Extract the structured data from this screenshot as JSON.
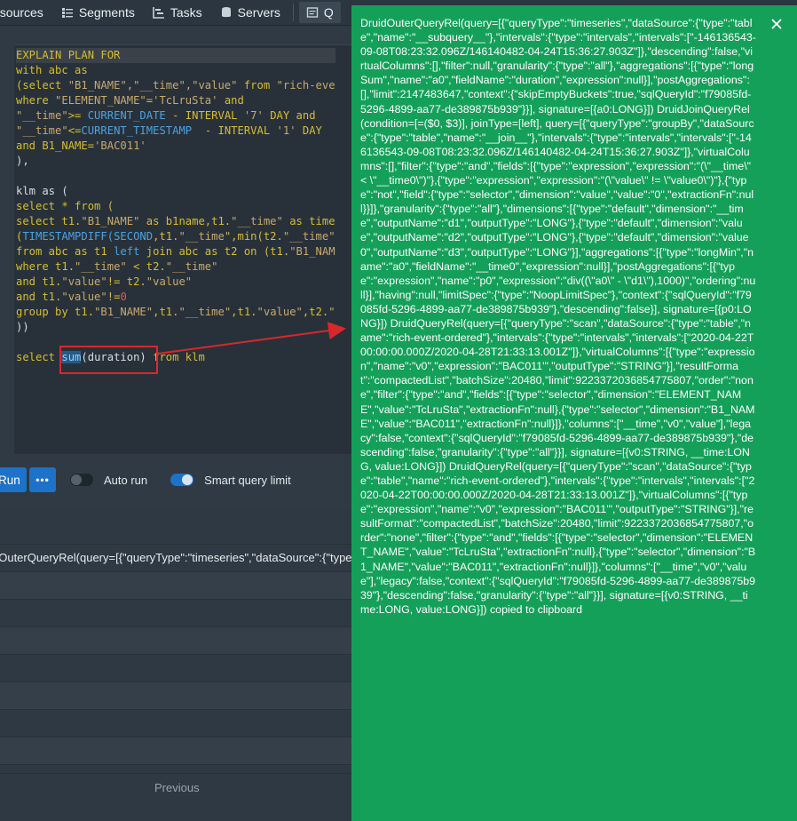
{
  "nav": {
    "items": [
      {
        "label": "asources",
        "icon": "datasource-icon"
      },
      {
        "label": "Segments",
        "icon": "segments-icon"
      },
      {
        "label": "Tasks",
        "icon": "tasks-icon"
      },
      {
        "label": "Servers",
        "icon": "servers-icon"
      },
      {
        "label": "Q",
        "icon": "query-icon"
      }
    ]
  },
  "editor": {
    "lines": [
      [
        {
          "t": "EXPLAIN PLAN FOR",
          "c": "y"
        }
      ],
      [
        {
          "t": "with abc as",
          "c": "y"
        }
      ],
      [
        {
          "t": "(select ",
          "c": "y"
        },
        {
          "t": "\"B1_NAME\",\"__time\",\"value\"",
          "c": "s"
        },
        {
          "t": " from ",
          "c": "y"
        },
        {
          "t": "\"rich-eve",
          "c": "s"
        }
      ],
      [
        {
          "t": "where ",
          "c": "y"
        },
        {
          "t": "\"ELEMENT_NAME\"",
          "c": "s"
        },
        {
          "t": "=",
          "c": "y"
        },
        {
          "t": "'TcLruSta'",
          "c": "s"
        },
        {
          "t": " and",
          "c": "y"
        }
      ],
      [
        {
          "t": "\"__time\"",
          "c": "s"
        },
        {
          "t": ">= ",
          "c": "y"
        },
        {
          "t": "CURRENT_DATE",
          "c": "b"
        },
        {
          "t": " - INTERVAL ",
          "c": "y"
        },
        {
          "t": "'7'",
          "c": "s"
        },
        {
          "t": " DAY and",
          "c": "y"
        }
      ],
      [
        {
          "t": "\"__time\"",
          "c": "s"
        },
        {
          "t": "<=",
          "c": "y"
        },
        {
          "t": "CURRENT_TIMESTAMP",
          "c": "b"
        },
        {
          "t": "  - INTERVAL ",
          "c": "y"
        },
        {
          "t": "'1'",
          "c": "s"
        },
        {
          "t": " DAY",
          "c": "y"
        }
      ],
      [
        {
          "t": "and B1_NAME=",
          "c": "y"
        },
        {
          "t": "'BAC011'",
          "c": "s"
        }
      ],
      [
        {
          "t": "),",
          "c": "c"
        }
      ],
      [
        {
          "t": "",
          "c": "c"
        }
      ],
      [
        {
          "t": "klm as (",
          "c": "c"
        }
      ],
      [
        {
          "t": "select * from (",
          "c": "y"
        }
      ],
      [
        {
          "t": "select t1.",
          "c": "y"
        },
        {
          "t": "\"B1_NAME\"",
          "c": "s"
        },
        {
          "t": " as b1name,t1.",
          "c": "y"
        },
        {
          "t": "\"__time\"",
          "c": "s"
        },
        {
          "t": " as time",
          "c": "y"
        }
      ],
      [
        {
          "t": "(",
          "c": "y"
        },
        {
          "t": "TIMESTAMPDIFF(SECOND",
          "c": "b"
        },
        {
          "t": ",t1.",
          "c": "y"
        },
        {
          "t": "\"__time\"",
          "c": "s"
        },
        {
          "t": ",min(t2.",
          "c": "y"
        },
        {
          "t": "\"__time\"",
          "c": "s"
        }
      ],
      [
        {
          "t": "from abc as t1 ",
          "c": "y"
        },
        {
          "t": "left",
          "c": "b"
        },
        {
          "t": " join abc as t2 on (t1.",
          "c": "y"
        },
        {
          "t": "\"B1_NAM",
          "c": "s"
        }
      ],
      [
        {
          "t": "where t1.",
          "c": "y"
        },
        {
          "t": "\"__time\"",
          "c": "s"
        },
        {
          "t": " < t2.",
          "c": "y"
        },
        {
          "t": "\"__time\"",
          "c": "s"
        }
      ],
      [
        {
          "t": "and t1.",
          "c": "y"
        },
        {
          "t": "\"value\"",
          "c": "s"
        },
        {
          "t": "!= t2.",
          "c": "y"
        },
        {
          "t": "\"value\"",
          "c": "s"
        }
      ],
      [
        {
          "t": "and t1.",
          "c": "y"
        },
        {
          "t": "\"value\"",
          "c": "s"
        },
        {
          "t": "!=",
          "c": "y"
        },
        {
          "t": "0",
          "c": "n"
        }
      ],
      [
        {
          "t": "group by t1.",
          "c": "y"
        },
        {
          "t": "\"B1_NAME\"",
          "c": "s"
        },
        {
          "t": ",t1.",
          "c": "y"
        },
        {
          "t": "\"__time\"",
          "c": "s"
        },
        {
          "t": ",t1.",
          "c": "y"
        },
        {
          "t": "\"value\"",
          "c": "s"
        },
        {
          "t": ",t2.",
          "c": "y"
        },
        {
          "t": "\"",
          "c": "s"
        }
      ],
      [
        {
          "t": "))",
          "c": "c"
        }
      ],
      [
        {
          "t": "",
          "c": "c"
        }
      ],
      [
        {
          "t": "select ",
          "c": "y"
        },
        {
          "t": "sum",
          "c": "sel"
        },
        {
          "t": "(duration)",
          "c": "c"
        },
        {
          "t": " from klm",
          "c": "y"
        }
      ]
    ]
  },
  "runbar": {
    "run_label": "Run",
    "more_label": "•••",
    "auto_run_label": "Auto run",
    "auto_run_on": false,
    "smart_limit_label": "Smart query limit",
    "smart_limit_on": true
  },
  "results": {
    "header": "l",
    "first_row": "dOuterQueryRel(query=[{\"queryType\":\"timeseries\",\"dataSource\":{\"type",
    "pager_previous": "Previous"
  },
  "toast": {
    "message": "DruidOuterQueryRel(query=[{\"queryType\":\"timeseries\",\"dataSource\":{\"type\":\"table\",\"name\":\"__subquery__\"},\"intervals\":{\"type\":\"intervals\",\"intervals\":[\"-146136543-09-08T08:23:32.096Z/146140482-04-24T15:36:27.903Z\"]},\"descending\":false,\"virtualColumns\":[],\"filter\":null,\"granularity\":{\"type\":\"all\"},\"aggregations\":[{\"type\":\"longSum\",\"name\":\"a0\",\"fieldName\":\"duration\",\"expression\":null}],\"postAggregations\":[],\"limit\":2147483647,\"context\":{\"skipEmptyBuckets\":true,\"sqlQueryId\":\"f79085fd-5296-4899-aa77-de389875b939\"}}], signature=[{a0:LONG}]) DruidJoinQueryRel(condition=[=($0, $3)], joinType=[left], query=[{\"queryType\":\"groupBy\",\"dataSource\":{\"type\":\"table\",\"name\":\"__join__\"},\"intervals\":{\"type\":\"intervals\",\"intervals\":[\"-146136543-09-08T08:23:32.096Z/146140482-04-24T15:36:27.903Z\"]},\"virtualColumns\":[],\"filter\":{\"type\":\"and\",\"fields\":[{\"type\":\"expression\",\"expression\":\"(\\\"__time\\\" < \\\"__time0\\\")\"},{\"type\":\"expression\",\"expression\":\"(\\\"value\\\" != \\\"value0\\\")\"},{\"type\":\"not\",\"field\":{\"type\":\"selector\",\"dimension\":\"value\",\"value\":\"0\",\"extractionFn\":null}}]},\"granularity\":{\"type\":\"all\"},\"dimensions\":[{\"type\":\"default\",\"dimension\":\"__time\",\"outputName\":\"d1\",\"outputType\":\"LONG\"},{\"type\":\"default\",\"dimension\":\"value\",\"outputName\":\"d2\",\"outputType\":\"LONG\"},{\"type\":\"default\",\"dimension\":\"value0\",\"outputName\":\"d3\",\"outputType\":\"LONG\"}],\"aggregations\":[{\"type\":\"longMin\",\"name\":\"a0\",\"fieldName\":\"__time0\",\"expression\":null}],\"postAggregations\":[{\"type\":\"expression\",\"name\":\"p0\",\"expression\":\"div((\\\"a0\\\" - \\\"d1\\\"),1000)\",\"ordering\":null}],\"having\":null,\"limitSpec\":{\"type\":\"NoopLimitSpec\"},\"context\":{\"sqlQueryId\":\"f79085fd-5296-4899-aa77-de389875b939\"},\"descending\":false}], signature=[{p0:LONG}]) DruidQueryRel(query=[{\"queryType\":\"scan\",\"dataSource\":{\"type\":\"table\",\"name\":\"rich-event-ordered\"},\"intervals\":{\"type\":\"intervals\",\"intervals\":[\"2020-04-22T00:00:00.000Z/2020-04-28T21:33:13.001Z\"]},\"virtualColumns\":[{\"type\":\"expression\",\"name\":\"v0\",\"expression\":\"BAC011'\",\"outputType\":\"STRING\"}],\"resultFormat\":\"compactedList\",\"batchSize\":20480,\"limit\":9223372036854775807,\"order\":\"none\",\"filter\":{\"type\":\"and\",\"fields\":[{\"type\":\"selector\",\"dimension\":\"ELEMENT_NAME\",\"value\":\"TcLruSta\",\"extractionFn\":null},{\"type\":\"selector\",\"dimension\":\"B1_NAME\",\"value\":\"BAC011\",\"extractionFn\":null}]},\"columns\":[\"__time\",\"v0\",\"value\"],\"legacy\":false,\"context\":{\"sqlQueryId\":\"f79085fd-5296-4899-aa77-de389875b939\"},\"descending\":false,\"granularity\":{\"type\":\"all\"}}], signature=[{v0:STRING, __time:LONG, value:LONG}]) DruidQueryRel(query=[{\"queryType\":\"scan\",\"dataSource\":{\"type\":\"table\",\"name\":\"rich-event-ordered\"},\"intervals\":{\"type\":\"intervals\",\"intervals\":[\"2020-04-22T00:00:00.000Z/2020-04-28T21:33:13.001Z\"]},\"virtualColumns\":[{\"type\":\"expression\",\"name\":\"v0\",\"expression\":\"BAC011'\",\"outputType\":\"STRING\"}],\"resultFormat\":\"compactedList\",\"batchSize\":20480,\"limit\":9223372036854775807,\"order\":\"none\",\"filter\":{\"type\":\"and\",\"fields\":[{\"type\":\"selector\",\"dimension\":\"ELEMENT_NAME\",\"value\":\"TcLruSta\",\"extractionFn\":null},{\"type\":\"selector\",\"dimension\":\"B1_NAME\",\"value\":\"BAC011\",\"extractionFn\":null}]},\"columns\":[\"__time\",\"v0\",\"value\"],\"legacy\":false,\"context\":{\"sqlQueryId\":\"f79085fd-5296-4899-aa77-de389875b939\"},\"descending\":false,\"granularity\":{\"type\":\"all\"}}], signature=[{v0:STRING, __time:LONG, value:LONG}]) copied to clipboard",
    "close_icon": "close-icon"
  },
  "colors": {
    "toast_bg": "#15a05a",
    "accent": "#1d72c9",
    "annotation_red": "#d8282c"
  }
}
